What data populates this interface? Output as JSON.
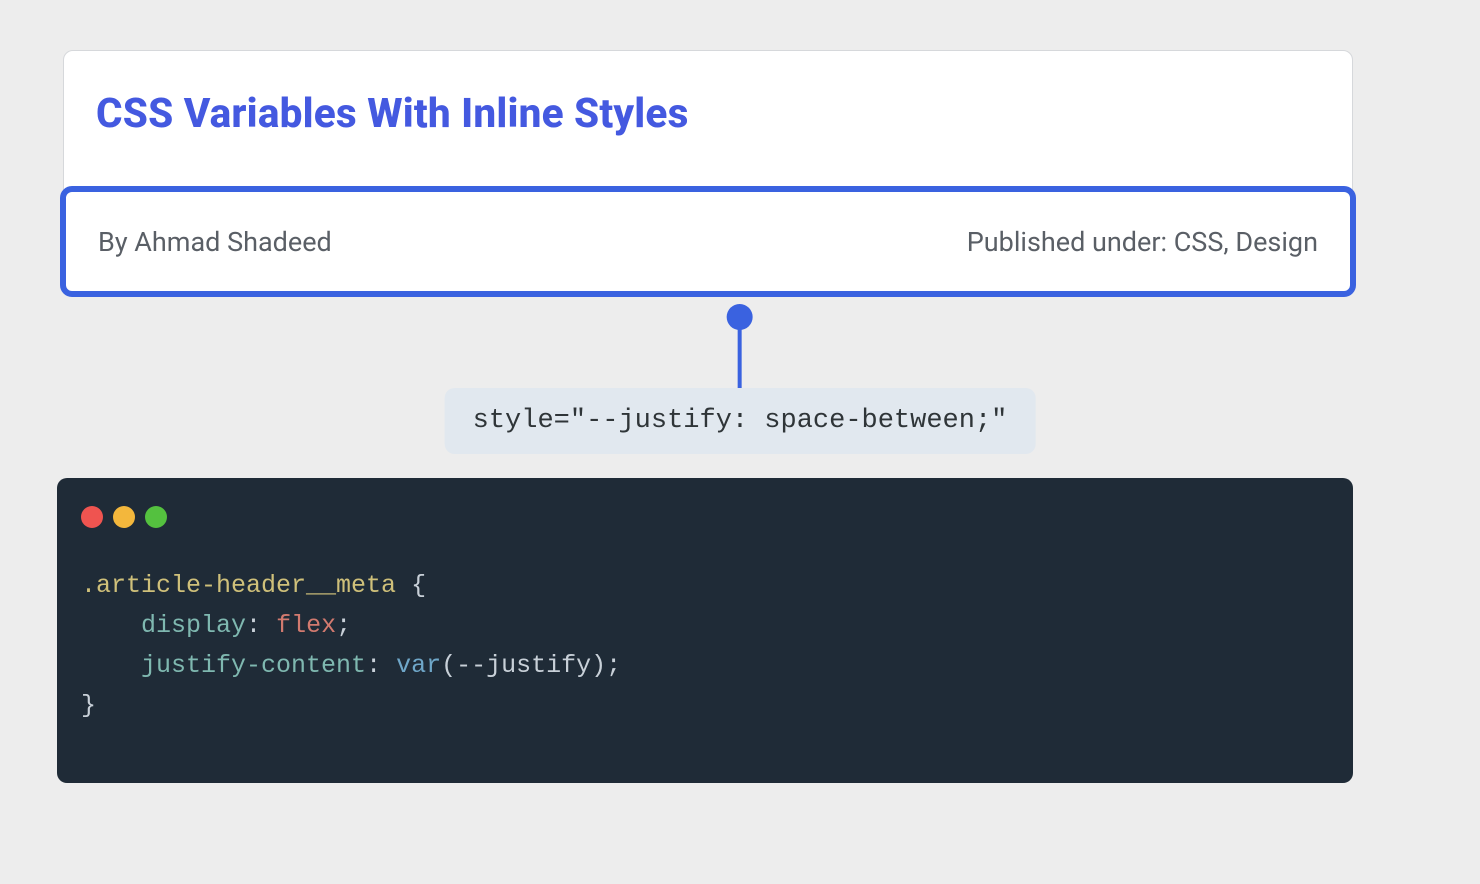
{
  "article": {
    "title": "CSS Variables With Inline Styles",
    "meta": {
      "author_label": "By Ahmad Shadeed",
      "published_label": "Published under: CSS, Design"
    }
  },
  "callout": {
    "text": "style=\"--justify: space-between;\""
  },
  "code": {
    "window_dots": [
      "red",
      "yellow",
      "green"
    ],
    "line1_selector": ".article-header__meta ",
    "line1_brace_open": "{",
    "line2_indent": "    ",
    "line2_prop": "display",
    "line2_colon": ": ",
    "line2_value": "flex",
    "line2_semi": ";",
    "line3_indent": "    ",
    "line3_prop": "justify-content",
    "line3_colon": ": ",
    "line3_func": "var",
    "line3_paren_open": "(",
    "line3_var": "--justify",
    "line3_paren_close": ")",
    "line3_semi": ";",
    "line4_brace_close": "}"
  }
}
